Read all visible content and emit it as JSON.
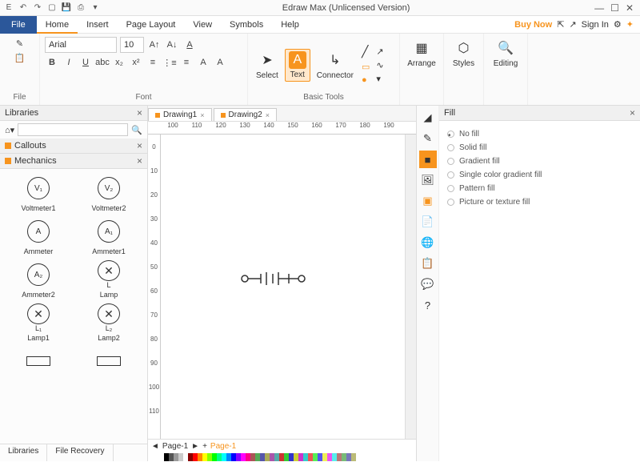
{
  "title": "Edraw Max (Unlicensed Version)",
  "menubar": {
    "file": "File",
    "items": [
      "Home",
      "Insert",
      "Page Layout",
      "View",
      "Symbols",
      "Help"
    ],
    "buynow": "Buy Now",
    "signin": "Sign In"
  },
  "ribbon": {
    "file_label": "File",
    "font": {
      "label": "Font",
      "family": "Arial",
      "size": "10"
    },
    "basictools": {
      "label": "Basic Tools",
      "select": "Select",
      "text": "Text",
      "connector": "Connector"
    },
    "arrange": "Arrange",
    "styles": "Styles",
    "editing": "Editing"
  },
  "left": {
    "libraries": "Libraries",
    "callouts": "Callouts",
    "mechanics": "Mechanics",
    "shapes": [
      {
        "sym": "V₁",
        "name": "Voltmeter1"
      },
      {
        "sym": "V₂",
        "name": "Voltmeter2"
      },
      {
        "sym": "A",
        "name": "Ammeter"
      },
      {
        "sym": "A₁",
        "name": "Ammeter1"
      },
      {
        "sym": "A₂",
        "name": "Ammeter2"
      },
      {
        "sym": "x",
        "sub": "L",
        "name": "Lamp"
      },
      {
        "sym": "x",
        "sub": "L₁",
        "name": "Lamp1"
      },
      {
        "sym": "x",
        "sub": "L₂",
        "name": "Lamp2"
      },
      {
        "rect": true,
        "name": ""
      },
      {
        "rect": true,
        "name": ""
      }
    ],
    "tabs": [
      "Libraries",
      "File Recovery"
    ]
  },
  "doctabs": [
    {
      "name": "Drawing1"
    },
    {
      "name": "Drawing2"
    }
  ],
  "ruler_h": [
    "100",
    "110",
    "120",
    "130",
    "140",
    "150",
    "160",
    "170",
    "180",
    "190"
  ],
  "ruler_v": [
    "0",
    "10",
    "20",
    "30",
    "40",
    "50",
    "60",
    "70",
    "80",
    "90",
    "100",
    "110"
  ],
  "pagetabs": {
    "page1": "Page-1",
    "page1b": "Page-1",
    "add": "+"
  },
  "right": {
    "title": "Fill",
    "options": [
      "No fill",
      "Solid fill",
      "Gradient fill",
      "Single color gradient fill",
      "Pattern fill",
      "Picture or texture fill"
    ]
  },
  "colors": [
    "#000",
    "#555",
    "#999",
    "#ccc",
    "#fff",
    "#800",
    "#f00",
    "#f80",
    "#ff0",
    "#8f0",
    "#0f0",
    "#0f8",
    "#0ff",
    "#08f",
    "#00f",
    "#80f",
    "#f0f",
    "#f08",
    "#a55",
    "#5a5",
    "#55a",
    "#aa5",
    "#a5a",
    "#5aa",
    "#c33",
    "#3c3",
    "#33c",
    "#cc3",
    "#c3c",
    "#3cc",
    "#e55",
    "#5e5",
    "#55e",
    "#ee5",
    "#e5e",
    "#5ee",
    "#b77",
    "#7b7",
    "#77b",
    "#bb7"
  ]
}
